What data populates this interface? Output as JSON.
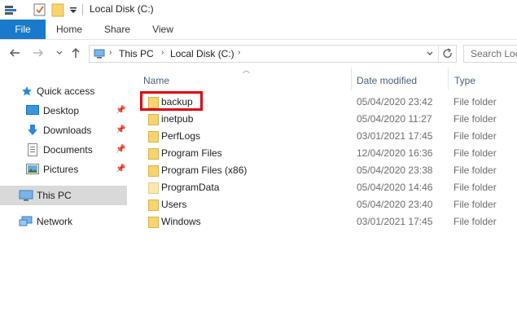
{
  "window": {
    "title": "Local Disk (C:)"
  },
  "ribbon": {
    "file": "File",
    "home": "Home",
    "share": "Share",
    "view": "View"
  },
  "address": {
    "this_pc": "This PC",
    "local_disk": "Local Disk (C:)",
    "search_placeholder": "Search Loc"
  },
  "nav": {
    "quick_access": "Quick access",
    "desktop": "Desktop",
    "downloads": "Downloads",
    "documents": "Documents",
    "pictures": "Pictures",
    "this_pc": "This PC",
    "network": "Network"
  },
  "columns": {
    "name": "Name",
    "date": "Date modified",
    "type": "Type"
  },
  "files": [
    {
      "name": "backup",
      "date": "05/04/2020 23:42",
      "type": "File folder"
    },
    {
      "name": "inetpub",
      "date": "05/04/2020 11:27",
      "type": "File folder"
    },
    {
      "name": "PerfLogs",
      "date": "03/01/2021 17:45",
      "type": "File folder"
    },
    {
      "name": "Program Files",
      "date": "12/04/2020 16:36",
      "type": "File folder"
    },
    {
      "name": "Program Files (x86)",
      "date": "05/04/2020 23:38",
      "type": "File folder"
    },
    {
      "name": "ProgramData",
      "date": "05/04/2020 14:46",
      "type": "File folder"
    },
    {
      "name": "Users",
      "date": "05/04/2020 23:40",
      "type": "File folder"
    },
    {
      "name": "Windows",
      "date": "03/01/2021 17:45",
      "type": "File folder"
    }
  ],
  "colors": {
    "file_tab": "#1979ca",
    "folder": "#f7d470",
    "highlight": "#e0000f",
    "selected_nav": "#d9d9d9"
  }
}
